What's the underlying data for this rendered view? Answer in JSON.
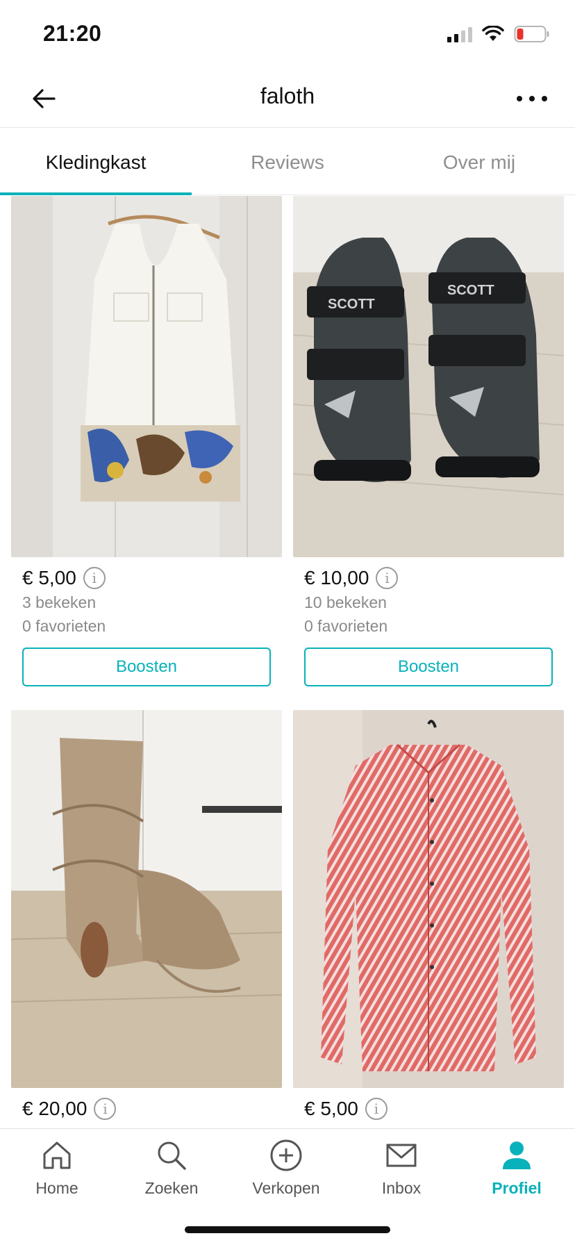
{
  "status_bar": {
    "time": "21:20"
  },
  "header": {
    "title": "faloth"
  },
  "tabs": [
    {
      "label": "Kledingkast",
      "active": true
    },
    {
      "label": "Reviews",
      "active": false
    },
    {
      "label": "Over mij",
      "active": false
    }
  ],
  "items": [
    {
      "price": "€ 5,00",
      "views": "3 bekeken",
      "favorites": "0 favorieten",
      "boost_label": "Boosten",
      "image": "white-dress-photo"
    },
    {
      "price": "€ 10,00",
      "views": "10 bekeken",
      "favorites": "0 favorieten",
      "boost_label": "Boosten",
      "image": "cycling-shoes-photo",
      "brand_text": "SCOTT"
    },
    {
      "price": "€ 20,00",
      "image": "boots-photo"
    },
    {
      "price": "€ 5,00",
      "image": "red-shirt-photo"
    }
  ],
  "tabbar": [
    {
      "label": "Home",
      "icon": "home-icon"
    },
    {
      "label": "Zoeken",
      "icon": "search-icon"
    },
    {
      "label": "Verkopen",
      "icon": "plus-circle-icon"
    },
    {
      "label": "Inbox",
      "icon": "envelope-icon"
    },
    {
      "label": "Profiel",
      "icon": "person-icon",
      "active": true
    }
  ],
  "colors": {
    "accent": "#09b1ba",
    "text": "#111111",
    "muted": "#8a8a8a"
  }
}
